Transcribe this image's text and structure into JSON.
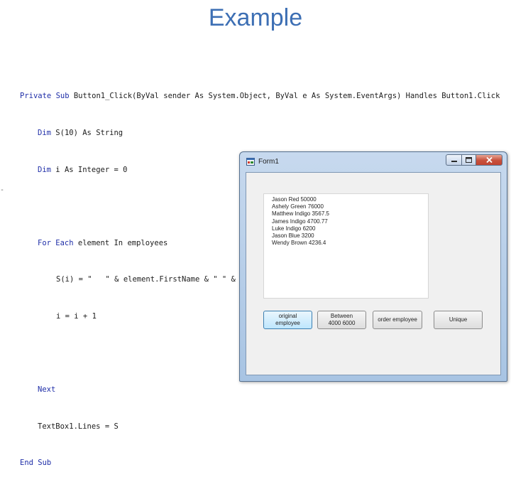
{
  "slide": {
    "title": "Example"
  },
  "code": {
    "lines": [
      "Private Sub Button1_Click(ByVal sender As System.Object, ByVal e As System.EventArgs) Handles Button1.Click",
      "Dim S(10) As String",
      "Dim i As Integer = 0",
      "",
      "For Each element In employees",
      "S(i) = \"   \" & element.FirstName & \" \" & element.LastName & \"   \" & element.monthlySalary",
      "i = i + 1",
      "",
      "Next",
      "TextBox1.Lines = S",
      "End Sub"
    ]
  },
  "form": {
    "title": "Form1",
    "textbox_lines": [
      "Jason Red  50000",
      "Ashely Green  76000",
      "Matthew Indigo  3567.5",
      "James Indigo  4700.77",
      "Luke Indigo  6200",
      "Jason Blue  3200",
      "Wendy Brown  4236.4"
    ],
    "buttons": {
      "original": [
        "original",
        "employee"
      ],
      "between": [
        "Between",
        "4000 6000"
      ],
      "order": "order employee",
      "unique": "Unique"
    }
  },
  "colors": {
    "title": "#3d6fb4",
    "keyword": "#1f2ea8"
  }
}
